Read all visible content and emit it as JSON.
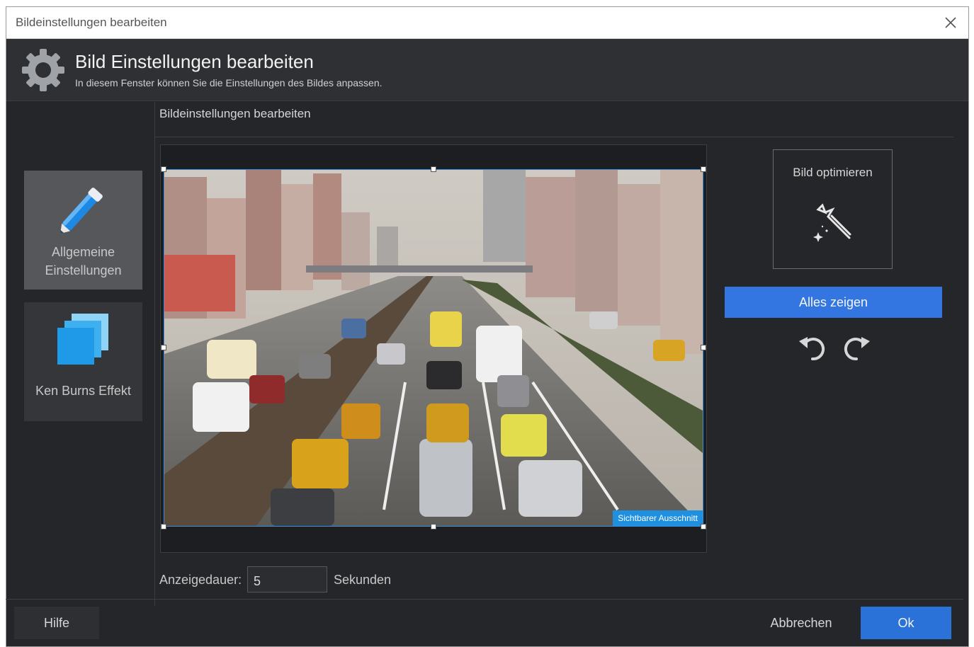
{
  "window": {
    "title": "Bildeinstellungen bearbeiten"
  },
  "header": {
    "title": "Bild Einstellungen bearbeiten",
    "subtitle": "In diesem Fenster können Sie die Einstellungen des Bildes anpassen.",
    "icon": "gear-icon"
  },
  "sidebar": {
    "items": [
      {
        "label_line1": "Allgemeine",
        "label_line2": "Einstellungen",
        "icon": "pen-icon",
        "active": true
      },
      {
        "label": "Ken Burns Effekt",
        "icon": "ken-burns-icon",
        "active": false
      }
    ]
  },
  "main": {
    "section_title": "Bildeinstellungen bearbeiten",
    "preview": {
      "visible_area_badge": "Sichtbarer Ausschnitt"
    },
    "optimize": {
      "label": "Bild optimieren",
      "icon": "magic-wand-icon"
    },
    "show_all_label": "Alles zeigen",
    "rotate_left_icon": "rotate-left-icon",
    "rotate_right_icon": "rotate-right-icon",
    "duration": {
      "label": "Anzeigedauer:",
      "value": "5",
      "unit": "Sekunden"
    }
  },
  "footer": {
    "help_label": "Hilfe",
    "cancel_label": "Abbrechen",
    "ok_label": "Ok"
  },
  "colors": {
    "accent": "#3476e1",
    "window_bg": "#252629",
    "selection_border": "#3a8fd8"
  }
}
